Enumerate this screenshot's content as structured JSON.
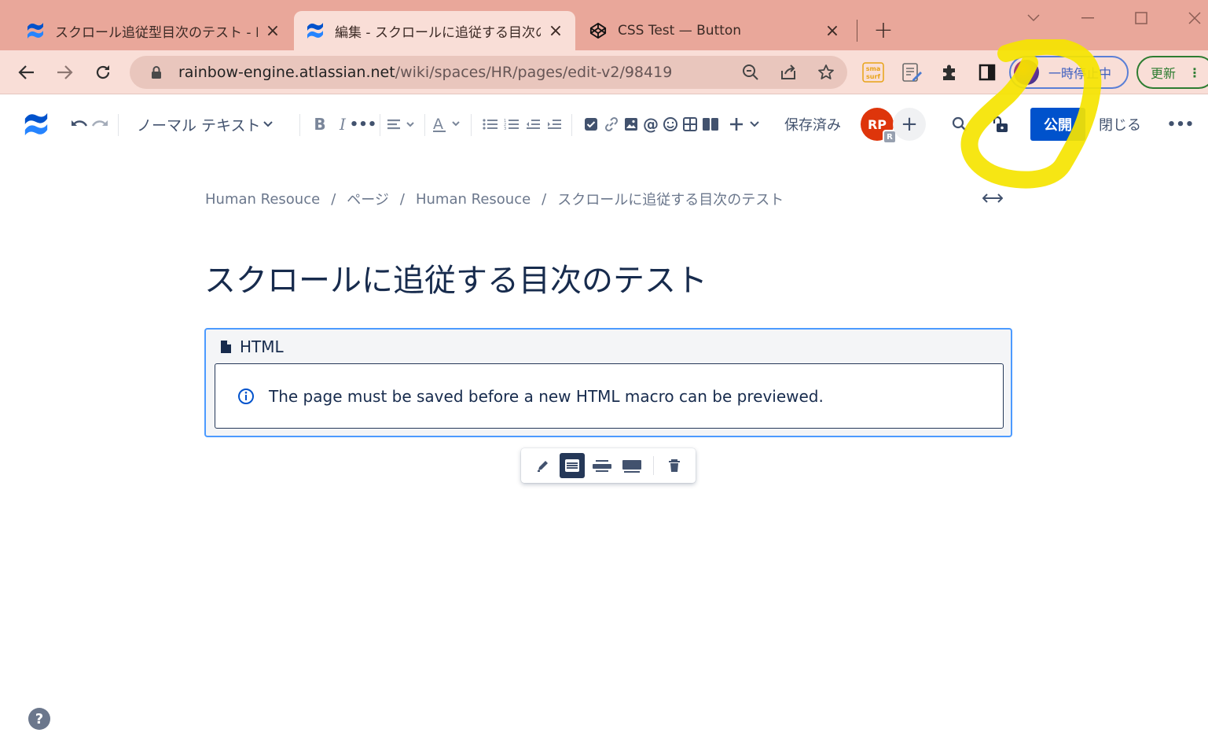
{
  "browser": {
    "tabs": [
      {
        "title": "スクロール追従型目次のテスト - Hun",
        "active": false
      },
      {
        "title": "編集 - スクロールに追従する目次のテ",
        "active": true
      },
      {
        "title": "CSS Test — Button",
        "active": false
      }
    ],
    "url_host": "rainbow-engine.atlassian.net",
    "url_path": "/wiki/spaces/HR/pages/edit-v2/98419",
    "profile_label": "一時停止中",
    "update_label": "更新",
    "colors": {
      "tabstrip": "#e9a79a",
      "toolbar": "#f9ded7",
      "profile_border": "#5a7fd6",
      "update_border": "#2e7d32"
    }
  },
  "editor_toolbar": {
    "text_style": "ノーマル テキスト",
    "saved_status": "保存済み",
    "avatar_initials": "RP",
    "avatar_sub": "R",
    "publish_label": "公開",
    "close_label": "閉じる",
    "colors": {
      "publish": "#0052cc",
      "avatar": "#de350b"
    }
  },
  "breadcrumb": {
    "items": [
      "Human Resouce",
      "ページ",
      "Human Resouce",
      "スクロールに追従する目次のテスト"
    ],
    "separator": "/"
  },
  "page": {
    "title": "スクロールに追従する目次のテスト"
  },
  "macro": {
    "name": "HTML",
    "message": "The page must be saved before a new HTML macro can be previewed."
  },
  "help": {
    "label": "?"
  }
}
